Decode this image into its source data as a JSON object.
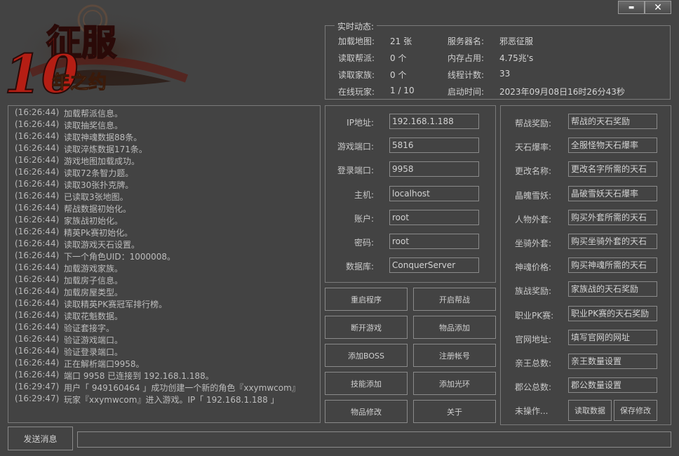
{
  "window": {
    "minimize_glyph": "▬",
    "close_glyph": "✕"
  },
  "logo": {
    "title": "征服",
    "number": "10",
    "subtitle": "年之约"
  },
  "status": {
    "legend": "实时动态:",
    "rows": [
      {
        "label": "加载地图:",
        "value": "21 张"
      },
      {
        "label": "读取帮派:",
        "value": "0 个"
      },
      {
        "label": "读取家族:",
        "value": "0 个"
      },
      {
        "label": "在线玩家:",
        "value": "1 / 10"
      }
    ],
    "rows2": [
      {
        "label": "服务器名:",
        "value": "邪恶征服"
      },
      {
        "label": "内存占用:",
        "value": "4.75兆's"
      },
      {
        "label": "线程计数:",
        "value": "33"
      },
      {
        "label": "启动时间:",
        "value": "2023年09月08日16时26分43秒"
      }
    ]
  },
  "log": [
    {
      "time": "(16:26:44)",
      "msg": "加载帮派信息。"
    },
    {
      "time": "(16:26:44)",
      "msg": "读取抽奖信息。"
    },
    {
      "time": "(16:26:44)",
      "msg": "读取神魂数据88条。"
    },
    {
      "time": "(16:26:44)",
      "msg": "读取淬炼数据171条。"
    },
    {
      "time": "(16:26:44)",
      "msg": "游戏地图加载成功。"
    },
    {
      "time": "(16:26:44)",
      "msg": "读取72条智力题。"
    },
    {
      "time": "(16:26:44)",
      "msg": "读取30张扑克牌。"
    },
    {
      "time": "(16:26:44)",
      "msg": "已读取3张地图。"
    },
    {
      "time": "(16:26:44)",
      "msg": "帮战数据初始化。"
    },
    {
      "time": "(16:26:44)",
      "msg": "家族战初始化。"
    },
    {
      "time": "(16:26:44)",
      "msg": "精英Pk赛初始化。"
    },
    {
      "time": "(16:26:44)",
      "msg": "读取游戏天石设置。"
    },
    {
      "time": "(16:26:44)",
      "msg": "下一个角色UID：1000008。"
    },
    {
      "time": "(16:26:44)",
      "msg": "加载游戏家族。"
    },
    {
      "time": "(16:26:44)",
      "msg": "加载房子信息。"
    },
    {
      "time": "(16:26:44)",
      "msg": "加载房屋类型。"
    },
    {
      "time": "(16:26:44)",
      "msg": "读取精英PK赛冠军排行榜。"
    },
    {
      "time": "(16:26:44)",
      "msg": "读取花魁数据。"
    },
    {
      "time": "(16:26:44)",
      "msg": "验证套接字。"
    },
    {
      "time": "(16:26:44)",
      "msg": "验证游戏端口。"
    },
    {
      "time": "(16:26:44)",
      "msg": "验证登录端口。"
    },
    {
      "time": "(16:26:44)",
      "msg": "正在解析端口9958。"
    },
    {
      "time": "(16:26:44)",
      "msg": "端口 9958 已连接到 192.168.1.188。"
    },
    {
      "time": "(16:29:47)",
      "msg": "用户「 949160464 」成功创建一个新的角色『xxymwcom』"
    },
    {
      "time": "(16:29:47)",
      "msg": "玩家『xxymwcom』进入游戏。IP「 192.168.1.188 」"
    }
  ],
  "db": {
    "fields": [
      {
        "label": "IP地址:",
        "value": "192.168.1.188"
      },
      {
        "label": "游戏端口:",
        "value": "5816"
      },
      {
        "label": "登录端口:",
        "value": "9958"
      },
      {
        "label": "主机:",
        "value": "localhost"
      },
      {
        "label": "账户:",
        "value": "root"
      },
      {
        "label": "密码:",
        "value": "root"
      },
      {
        "label": "数据库:",
        "value": "ConquerServer"
      }
    ]
  },
  "actions": [
    [
      "重启程序",
      "开启帮战"
    ],
    [
      "断开游戏",
      "物品添加"
    ],
    [
      "添加BOSS",
      "注册帐号"
    ],
    [
      "技能添加",
      "添加光环"
    ],
    [
      "物品修改",
      "关于"
    ]
  ],
  "rewards": {
    "fields": [
      {
        "label": "帮战奖励:",
        "value": "帮战的天石奖励"
      },
      {
        "label": "天石爆率:",
        "value": "全服怪物天石爆率"
      },
      {
        "label": "更改名称:",
        "value": "更改名字所需的天石"
      },
      {
        "label": "晶魄雪妖:",
        "value": "晶破雪妖天石爆率"
      },
      {
        "label": "人物外套:",
        "value": "购买外套所需的天石"
      },
      {
        "label": "坐骑外套:",
        "value": "购买坐骑外套的天石"
      },
      {
        "label": "神魂价格:",
        "value": "购买神魂所需的天石"
      },
      {
        "label": "族战奖励:",
        "value": "家族战的天石奖励"
      },
      {
        "label": "职业PK赛:",
        "value": "职业PK赛的天石奖励"
      },
      {
        "label": "官网地址:",
        "value": "填写官网的网址"
      },
      {
        "label": "亲王总数:",
        "value": "亲王数量设置"
      },
      {
        "label": "郡公总数:",
        "value": "郡公数量设置"
      }
    ],
    "status": "未操作...",
    "read_button": "读取数据",
    "save_button": "保存修改"
  },
  "footer": {
    "send_button": "发送消息",
    "message_value": ""
  }
}
